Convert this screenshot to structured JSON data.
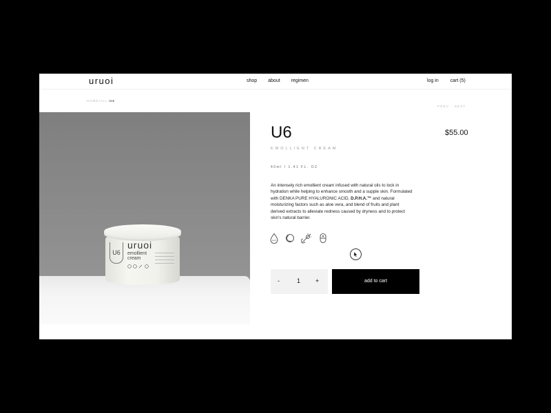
{
  "header": {
    "logo": "uruoi",
    "nav": [
      "shop",
      "about",
      "regimen"
    ],
    "login": "log in",
    "cart": "cart (5)"
  },
  "breadcrumb": {
    "home": "HOME",
    "all": "ALL",
    "current": "U6",
    "separator": "/"
  },
  "pager": {
    "prev": "PREV",
    "separator": "·",
    "next": "NEXT"
  },
  "product_image": {
    "jar_brand": "uruoi",
    "jar_letter": "U6",
    "jar_line1": "emollient",
    "jar_line2": "cream"
  },
  "product": {
    "title": "U6",
    "price": "$55.00",
    "subtitle": "EMOLLIENT CREAM",
    "size": "40ml / 1.41 FL. OZ",
    "description_part1": "An intensely rich emollient cream infused with natural oils to lock in hydration while helping to enhance smooth and a supple skin. Formulated with DENKA PURE HYALURONIC ACID, ",
    "description_strong": "D.P.H.A.™",
    "description_part2": " and natural moisturizing factors such as aloe vera, and blend of fruits and plant derived extracts to alleviate redness caused by dryness and to protect skin's natural barrier."
  },
  "icons": [
    "droplet-icon",
    "moon-icon",
    "no-sun-icon",
    "capsule-icon"
  ],
  "purchase": {
    "minus": "-",
    "quantity": "1",
    "plus": "+",
    "add_to_cart": "add to cart"
  }
}
